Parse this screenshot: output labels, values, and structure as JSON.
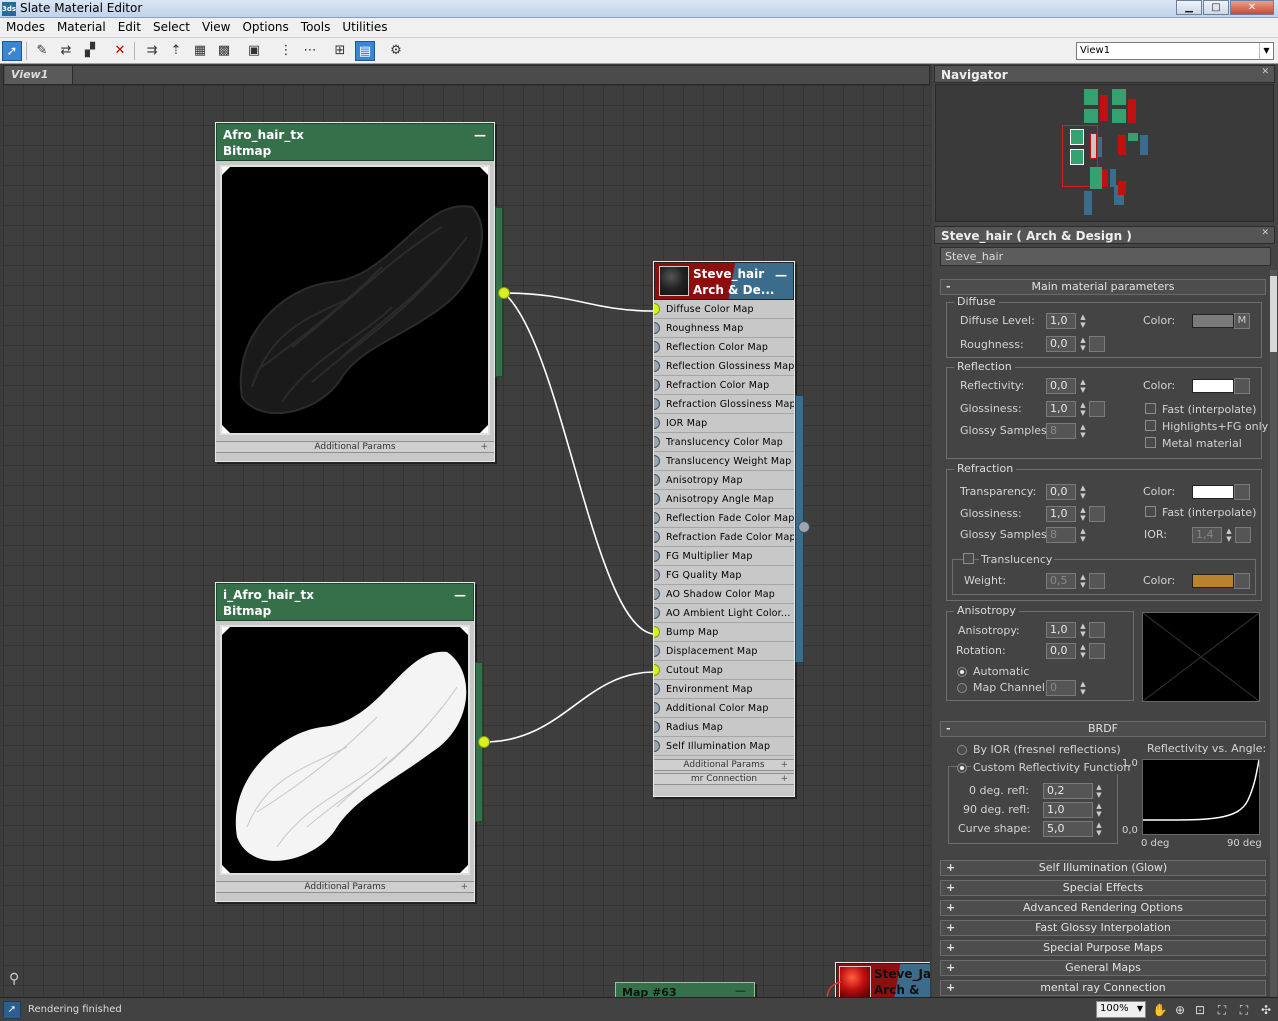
{
  "window": {
    "title": "Slate Material Editor",
    "minimize": "▁",
    "maximize": "□",
    "close": "✕"
  },
  "menu": [
    "Modes",
    "Material",
    "Edit",
    "Select",
    "View",
    "Options",
    "Tools",
    "Utilities"
  ],
  "toolbar": {
    "view_select": "View1"
  },
  "view_tab": "View1",
  "nodes": {
    "afro": {
      "name": "Afro_hair_tx",
      "type": "Bitmap",
      "additional": "Additional Params"
    },
    "iafro": {
      "name": "i_Afro_hair_tx",
      "type": "Bitmap",
      "additional": "Additional Params"
    },
    "steve": {
      "name": "Steve_hair",
      "type": "Arch & De...",
      "slots": [
        "Diffuse Color Map",
        "Roughness Map",
        "Reflection Color Map",
        "Reflection Glossiness Map",
        "Refraction Color Map",
        "Refraction Glossiness Map",
        "IOR Map",
        "Translucency Color Map",
        "Translucency Weight Map",
        "Anisotropy Map",
        "Anisotropy Angle Map",
        "Reflection Fade Color Map",
        "Refraction Fade Color Map",
        "FG Multiplier Map",
        "FG Quality Map",
        "AO Shadow Color Map",
        "AO Ambient Light Color...",
        "Bump Map",
        "Displacement Map",
        "Cutout Map",
        "Environment Map",
        "Additional Color Map",
        "Radius Map",
        "Self Illumination Map"
      ],
      "connected_slots": [
        0,
        17,
        19
      ],
      "additional": "Additional Params",
      "mr_connection": "mr Connection"
    },
    "map63": {
      "name": "Map #63"
    },
    "steve_ja": {
      "name": "Steve_Ja...",
      "type": "Arch & De..."
    }
  },
  "navigator": {
    "title": "Navigator"
  },
  "properties": {
    "title": "Steve_hair  ( Arch & Design )",
    "material_name": "Steve_hair",
    "main_rollout": "Main material parameters",
    "diffuse": {
      "group": "Diffuse",
      "level_label": "Diffuse Level:",
      "level": "1,0",
      "color_label": "Color:",
      "m": "M",
      "roughness_label": "Roughness:",
      "roughness": "0,0",
      "color": "#7a7a7a"
    },
    "reflection": {
      "group": "Reflection",
      "reflectivity_label": "Reflectivity:",
      "reflectivity": "0,0",
      "color_label": "Color:",
      "glossiness_label": "Glossiness:",
      "glossiness": "1,0",
      "samples_label": "Glossy Samples:",
      "samples": "8",
      "fast": "Fast (interpolate)",
      "highlights": "Highlights+FG only",
      "metal": "Metal material",
      "color": "#ffffff"
    },
    "refraction": {
      "group": "Refraction",
      "transparency_label": "Transparency:",
      "transparency": "0,0",
      "color_label": "Color:",
      "glossiness_label": "Glossiness:",
      "glossiness": "1,0",
      "samples_label": "Glossy Samples:",
      "samples": "8",
      "fast": "Fast (interpolate)",
      "ior_label": "IOR:",
      "ior": "1,4",
      "translucency": "Translucency",
      "weight_label": "Weight:",
      "weight": "0,5",
      "tcolor_label": "Color:",
      "color": "#ffffff",
      "tcolor": "#b8822e"
    },
    "anisotropy": {
      "group": "Anisotropy",
      "aniso_label": "Anisotropy:",
      "aniso": "1,0",
      "rotation_label": "Rotation:",
      "rotation": "0,0",
      "automatic": "Automatic",
      "map_channel_label": "Map Channel:",
      "map_channel": "0"
    },
    "brdf": {
      "title": "BRDF",
      "by_ior": "By IOR (fresnel reflections)",
      "custom": "Custom Reflectivity Function",
      "deg0_label": "0 deg. refl:",
      "deg0": "0,2",
      "deg90_label": "90 deg. refl:",
      "deg90": "1,0",
      "curve_label": "Curve shape:",
      "curve": "5,0",
      "graph_title": "Reflectivity vs. Angle:",
      "y_top": "1,0",
      "y_bottom": "0,0",
      "x_left": "0 deg",
      "x_right": "90 deg"
    },
    "collapsed": [
      "Self Illumination (Glow)",
      "Special Effects",
      "Advanced Rendering Options",
      "Fast Glossy Interpolation",
      "Special Purpose Maps",
      "General Maps",
      "mental ray Connection"
    ]
  },
  "status": {
    "text": "Rendering finished",
    "zoom": "100%"
  }
}
